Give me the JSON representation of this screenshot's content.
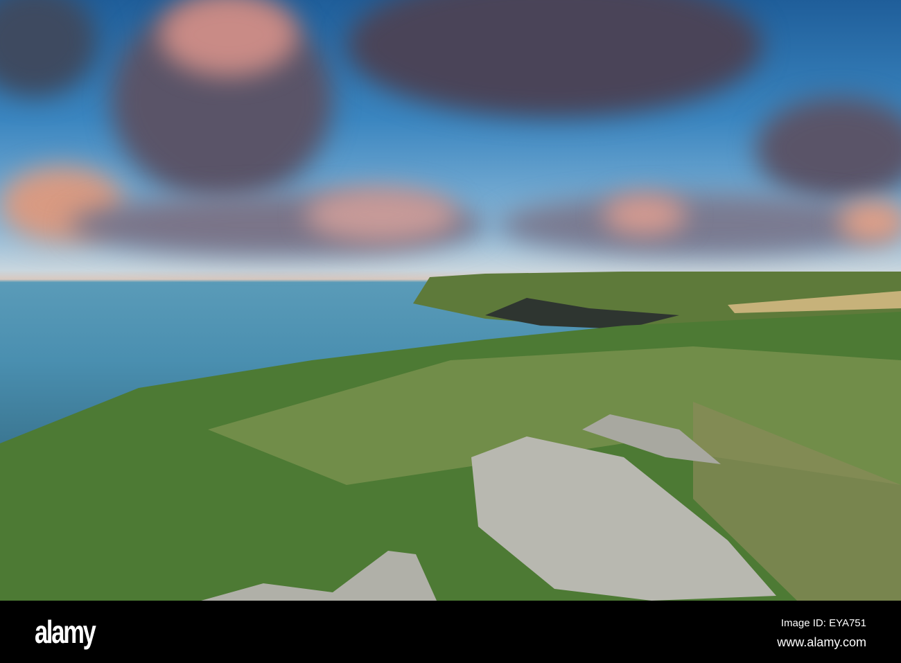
{
  "watermark": {
    "logo": "alamy",
    "image_id": "Image ID: EYA751",
    "url": "www.alamy.com"
  }
}
